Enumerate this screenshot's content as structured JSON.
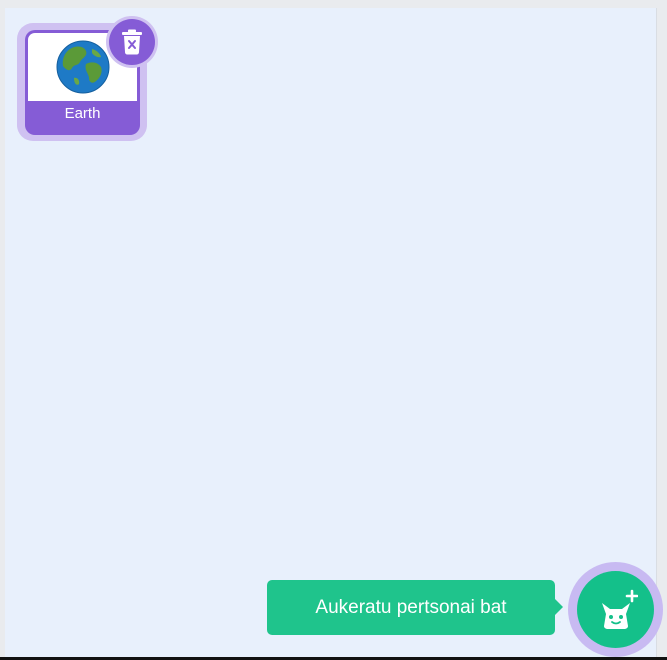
{
  "sprite_pane": {
    "background_color": "#e8f0fc",
    "sprites": [
      {
        "name": "Earth",
        "icon": "earth-globe-icon",
        "selected": true,
        "accent_color": "#855cd6"
      }
    ],
    "delete_icon": "trash-icon"
  },
  "add_sprite": {
    "tooltip": "Aukeratu pertsonai bat",
    "icon": "cat-plus-icon",
    "color": "#14c08a"
  }
}
